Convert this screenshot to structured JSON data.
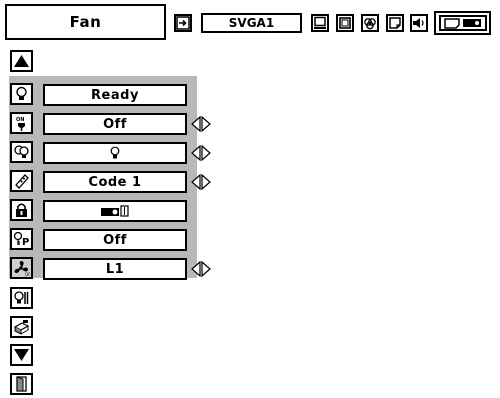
{
  "header": {
    "menu_title": "Fan",
    "source_name": "SVGA1",
    "top_icons": [
      "input-icon",
      "computer-icon",
      "screen-icon",
      "image-adjust-icon",
      "pc-adjust-icon",
      "sound-icon",
      "setting-icon"
    ]
  },
  "menu": {
    "scroll_up_icon": "up-triangle-icon",
    "scroll_down_icon": "down-triangle-icon",
    "exit_icon": "exit-door-icon",
    "rows": [
      {
        "icon": "lamp-status-icon",
        "value": "Ready",
        "adjustable": false
      },
      {
        "icon": "power-management-icon",
        "value": "Off",
        "adjustable": true
      },
      {
        "icon": "lamp-control-icon",
        "value": "lamp-glyph",
        "adjustable": true
      },
      {
        "icon": "remote-control-icon",
        "value": "Code 1",
        "adjustable": true
      },
      {
        "icon": "key-lock-icon",
        "value": "projector-glyph",
        "adjustable": false
      },
      {
        "icon": "pin-code-lock-icon",
        "value": "Off",
        "adjustable": false
      },
      {
        "icon": "fan-icon",
        "value": "L1",
        "adjustable": true,
        "selected": true
      }
    ],
    "extra_icons": [
      "lamp-counter-icon",
      "filter-counter-icon"
    ]
  }
}
